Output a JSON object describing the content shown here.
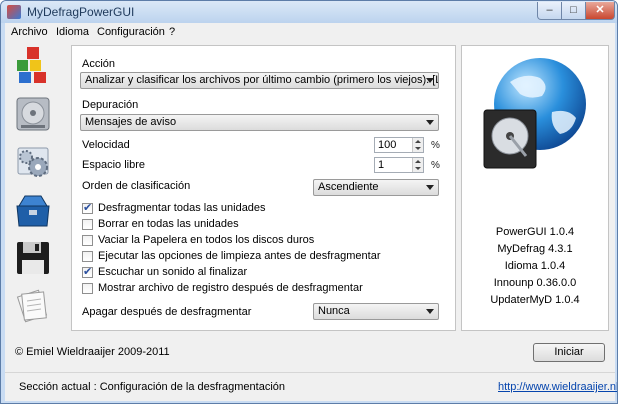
{
  "window": {
    "title": "MyDefragPowerGUI",
    "controls": {
      "minimize": "–",
      "maximize": "□",
      "close": "✕"
    }
  },
  "menu": [
    "Archivo",
    "Idioma",
    "Configuración",
    "?"
  ],
  "sidebar_icons": [
    "defrag-cubes-icon",
    "hard-drive-icon",
    "settings-gears-icon",
    "toolbox-icon",
    "floppy-disk-icon",
    "documents-icon"
  ],
  "settings": {
    "accion_label": "Acción",
    "accion_value": "Analizar y clasificar los archivos por último cambio (primero los viejos). [LENTO]",
    "depuracion_label": "Depuración",
    "depuracion_value": "Mensajes de aviso",
    "velocidad_label": "Velocidad",
    "velocidad_value": "100",
    "espacio_label": "Espacio libre",
    "espacio_value": "1",
    "unit": "%",
    "orden_label": "Orden de clasificación",
    "orden_value": "Ascendiente",
    "checkboxes": [
      {
        "label": "Desfragmentar todas las unidades",
        "checked": true
      },
      {
        "label": "Borrar en todas las unidades",
        "checked": false
      },
      {
        "label": "Vaciar la Papelera en todos los discos duros",
        "checked": false
      },
      {
        "label": "Ejecutar las opciones de limpieza antes de desfragmentar",
        "checked": false
      },
      {
        "label": "Escuchar un sonido al finalizar",
        "checked": true
      },
      {
        "label": "Mostrar archivo de registro después de desfragmentar",
        "checked": false
      }
    ],
    "apagar_label": "Apagar después de desfragmentar",
    "apagar_value": "Nunca"
  },
  "versions": [
    "PowerGUI 1.0.4",
    "MyDefrag 4.3.1",
    "Idioma 1.0.4",
    "Innounp 0.36.0.0",
    "UpdaterMyD 1.0.4"
  ],
  "footer": {
    "copyright": "© Emiel Wieldraaijer 2009-2011",
    "start_button": "Iniciar"
  },
  "status": {
    "section": "Sección actual : Configuración de la desfragmentación",
    "link": "http://www.wieldraaijer.nl"
  }
}
